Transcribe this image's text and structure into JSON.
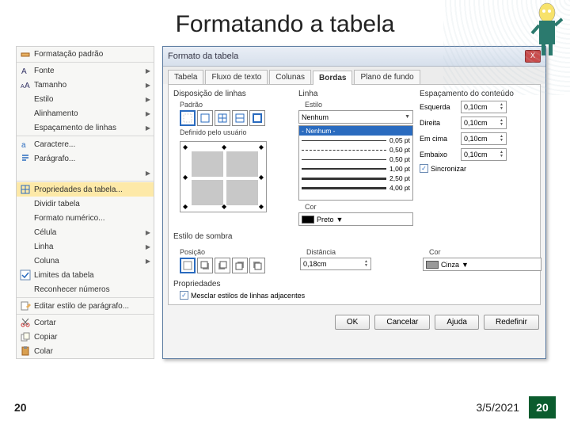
{
  "slide": {
    "title": "Formatando a tabela",
    "page_left": "20",
    "date": "3/5/2021",
    "page_badge": "20"
  },
  "menu": {
    "items": [
      {
        "label": "Formatação padrão",
        "icon": "clear",
        "arrow": false
      },
      {
        "sep": true
      },
      {
        "label": "Fonte",
        "icon": "font",
        "arrow": true
      },
      {
        "label": "Tamanho",
        "icon": "size",
        "arrow": true
      },
      {
        "label": "Estilo",
        "icon": "",
        "arrow": true
      },
      {
        "label": "Alinhamento",
        "icon": "",
        "arrow": true
      },
      {
        "label": "Espaçamento de linhas",
        "icon": "",
        "arrow": true
      },
      {
        "sep": true
      },
      {
        "label": "Caractere...",
        "icon": "char",
        "arrow": false
      },
      {
        "label": "Parágrafo...",
        "icon": "para",
        "arrow": false
      },
      {
        "label": "",
        "icon": "",
        "arrow": true
      },
      {
        "sep": true
      },
      {
        "label": "Propriedades da tabela...",
        "icon": "tableprops",
        "arrow": false,
        "hl": true
      },
      {
        "label": "Dividir tabela",
        "icon": "",
        "arrow": false
      },
      {
        "label": "Formato numérico...",
        "icon": "",
        "arrow": false
      },
      {
        "label": "Célula",
        "icon": "",
        "arrow": true
      },
      {
        "label": "Linha",
        "icon": "",
        "arrow": true
      },
      {
        "label": "Coluna",
        "icon": "",
        "arrow": true
      },
      {
        "label": "Limites da tabela",
        "icon": "check",
        "arrow": false,
        "checked": true
      },
      {
        "label": "Reconhecer números",
        "icon": "",
        "arrow": false
      },
      {
        "sep": true
      },
      {
        "label": "Editar estilo de parágrafo...",
        "icon": "editpara",
        "arrow": false
      },
      {
        "sep": true
      },
      {
        "label": "Cortar",
        "icon": "cut",
        "arrow": false
      },
      {
        "label": "Copiar",
        "icon": "copy",
        "arrow": false
      },
      {
        "label": "Colar",
        "icon": "paste",
        "arrow": false
      }
    ]
  },
  "dialog": {
    "title": "Formato da tabela",
    "close": "X",
    "tabs": [
      "Tabela",
      "Fluxo de texto",
      "Colunas",
      "Bordas",
      "Plano de fundo"
    ],
    "active_tab": 3,
    "sections": {
      "lines": {
        "title": "Disposição de linhas",
        "preset_label": "Padrão",
        "userdef_label": "Definido pelo usuário"
      },
      "line": {
        "title": "Linha",
        "style_label": "Estilo",
        "style_selected": "Nenhum",
        "options": [
          {
            "label": "- Nenhum -",
            "sel": true
          },
          {
            "label": "0,05 pt",
            "w": "w1"
          },
          {
            "label": "0,50 pt",
            "w": "w1",
            "d": true
          },
          {
            "label": "0,50 pt",
            "w": "w1"
          },
          {
            "label": "1,00 pt",
            "w": "w2"
          },
          {
            "label": "2,50 pt",
            "w": "w3"
          },
          {
            "label": "4,00 pt",
            "w": "w3"
          }
        ],
        "color_label": "Cor",
        "color_value": "Preto"
      },
      "spacing": {
        "title": "Espaçamento do conteúdo",
        "rows": [
          {
            "label": "Esquerda",
            "value": "0,10cm"
          },
          {
            "label": "Direita",
            "value": "0,10cm"
          },
          {
            "label": "Em cima",
            "value": "0,10cm"
          },
          {
            "label": "Embaixo",
            "value": "0,10cm"
          }
        ],
        "sync_label": "Sincronizar"
      },
      "shadow": {
        "title": "Estilo de sombra",
        "pos_label": "Posição",
        "dist_label": "Distância",
        "dist_value": "0,18cm",
        "color_label": "Cor",
        "color_value": "Cinza"
      },
      "props": {
        "title": "Propriedades",
        "merge_label": "Mesclar estilos de linhas adjacentes"
      }
    },
    "buttons": [
      "OK",
      "Cancelar",
      "Ajuda",
      "Redefinir"
    ]
  }
}
